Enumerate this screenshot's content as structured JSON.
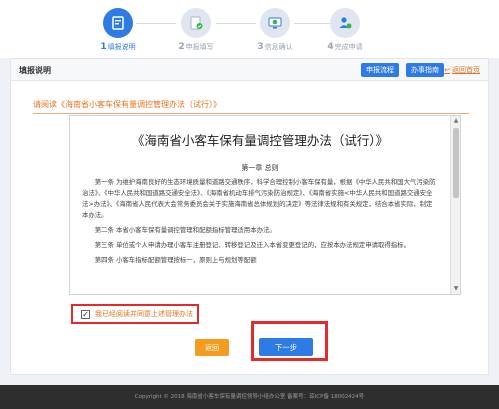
{
  "steps": [
    {
      "num": "1",
      "label": "填报说明",
      "icon": "form-icon",
      "active": true
    },
    {
      "num": "2",
      "label": "申报填写",
      "icon": "edit-form-icon",
      "active": false
    },
    {
      "num": "3",
      "label": "信息确认",
      "icon": "monitor-check-icon",
      "active": false
    },
    {
      "num": "4",
      "label": "完成申请",
      "icon": "user-check-icon",
      "active": false
    }
  ],
  "panel": {
    "title": "填报说明",
    "buttons": {
      "apply_flow": "申报流程",
      "guide": "办事指南",
      "back_home": "返回首页"
    }
  },
  "notice": "请阅读《海南省小客车保有量调控管理办法（试行）》",
  "document": {
    "title": "《海南省小客车保有量调控管理办法（试行）》",
    "chapter": "第一章  总则",
    "paragraphs": [
      "第一条  为维护海南良好的生态环境质量和道路交通秩序，科学合理控制小客车保有量，根据《中华人民共和国大气污染防治法》、《中华人民共和国道路交通安全法》、《海南省机动车排气污染防治规定》、《海南省实施<中华人民共和国道路交通安全法>办法》、《海南省人民代表大会常务委员会关于实施海南省总体规划的决定》等法律法规和有关规定，结合本省实际，制定本办法。",
      "第二条  本省小客车保有量调控管理和配额指标管理适用本办法。",
      "第三条  单位或个人申请办理小客车注册登记、转移登记及迁入本省变更登记的，应按本办法规定申请取得指标。",
      "第四条  小客车指标配额管理按标一，原则上与规划等配额"
    ]
  },
  "agree_label": "我已经阅读并同意上述管理办法",
  "agree_checked": true,
  "buttons": {
    "back": "返回",
    "next": "下一步"
  },
  "footer": "Copyright  © 2018   海南省小客车保有量调控领导小组办公室   备案号：琼ICP备 18002424号",
  "colors": {
    "primary": "#2f7be5",
    "orange": "#e8731c",
    "highlight_red": "#e32b2b",
    "footer_bg": "#2e2e2e"
  }
}
